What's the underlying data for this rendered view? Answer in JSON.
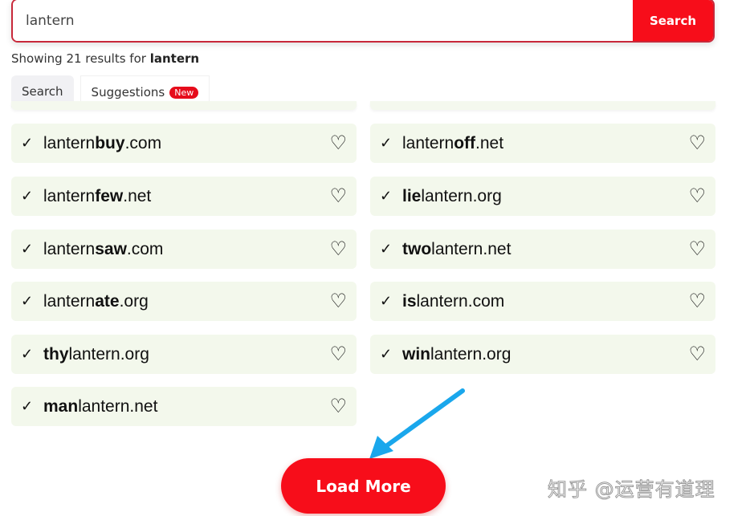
{
  "search": {
    "value": "lantern",
    "button_label": "Search"
  },
  "summary": {
    "prefix": "Showing 21 results for ",
    "term": "lantern"
  },
  "tabs": [
    {
      "label": "Search",
      "active": true
    },
    {
      "label": "Suggestions",
      "badge": "New"
    }
  ],
  "results": [
    {
      "base": "lantern",
      "word": "buy",
      "tld": ".com",
      "position": "suffix"
    },
    {
      "base": "lantern",
      "word": "off",
      "tld": ".net",
      "position": "suffix"
    },
    {
      "base": "lantern",
      "word": "few",
      "tld": ".net",
      "position": "suffix"
    },
    {
      "base": "lantern",
      "word": "lie",
      "tld": ".org",
      "position": "prefix"
    },
    {
      "base": "lantern",
      "word": "saw",
      "tld": ".com",
      "position": "suffix"
    },
    {
      "base": "lantern",
      "word": "two",
      "tld": ".net",
      "position": "prefix"
    },
    {
      "base": "lantern",
      "word": "ate",
      "tld": ".org",
      "position": "suffix"
    },
    {
      "base": "lantern",
      "word": "is",
      "tld": ".com",
      "position": "prefix"
    },
    {
      "base": "lantern",
      "word": "thy",
      "tld": ".org",
      "position": "prefix"
    },
    {
      "base": "lantern",
      "word": "win",
      "tld": ".org",
      "position": "prefix"
    },
    {
      "base": "lantern",
      "word": "man",
      "tld": ".net",
      "position": "prefix"
    }
  ],
  "load_more_label": "Load More",
  "watermark": "知乎 @运营有道理",
  "colors": {
    "accent": "#f70d1a",
    "card_bg": "#f3f8ec",
    "arrow": "#1aa7ec"
  },
  "icons": {
    "check": "check-icon",
    "favorite": "heart-outline-icon"
  }
}
